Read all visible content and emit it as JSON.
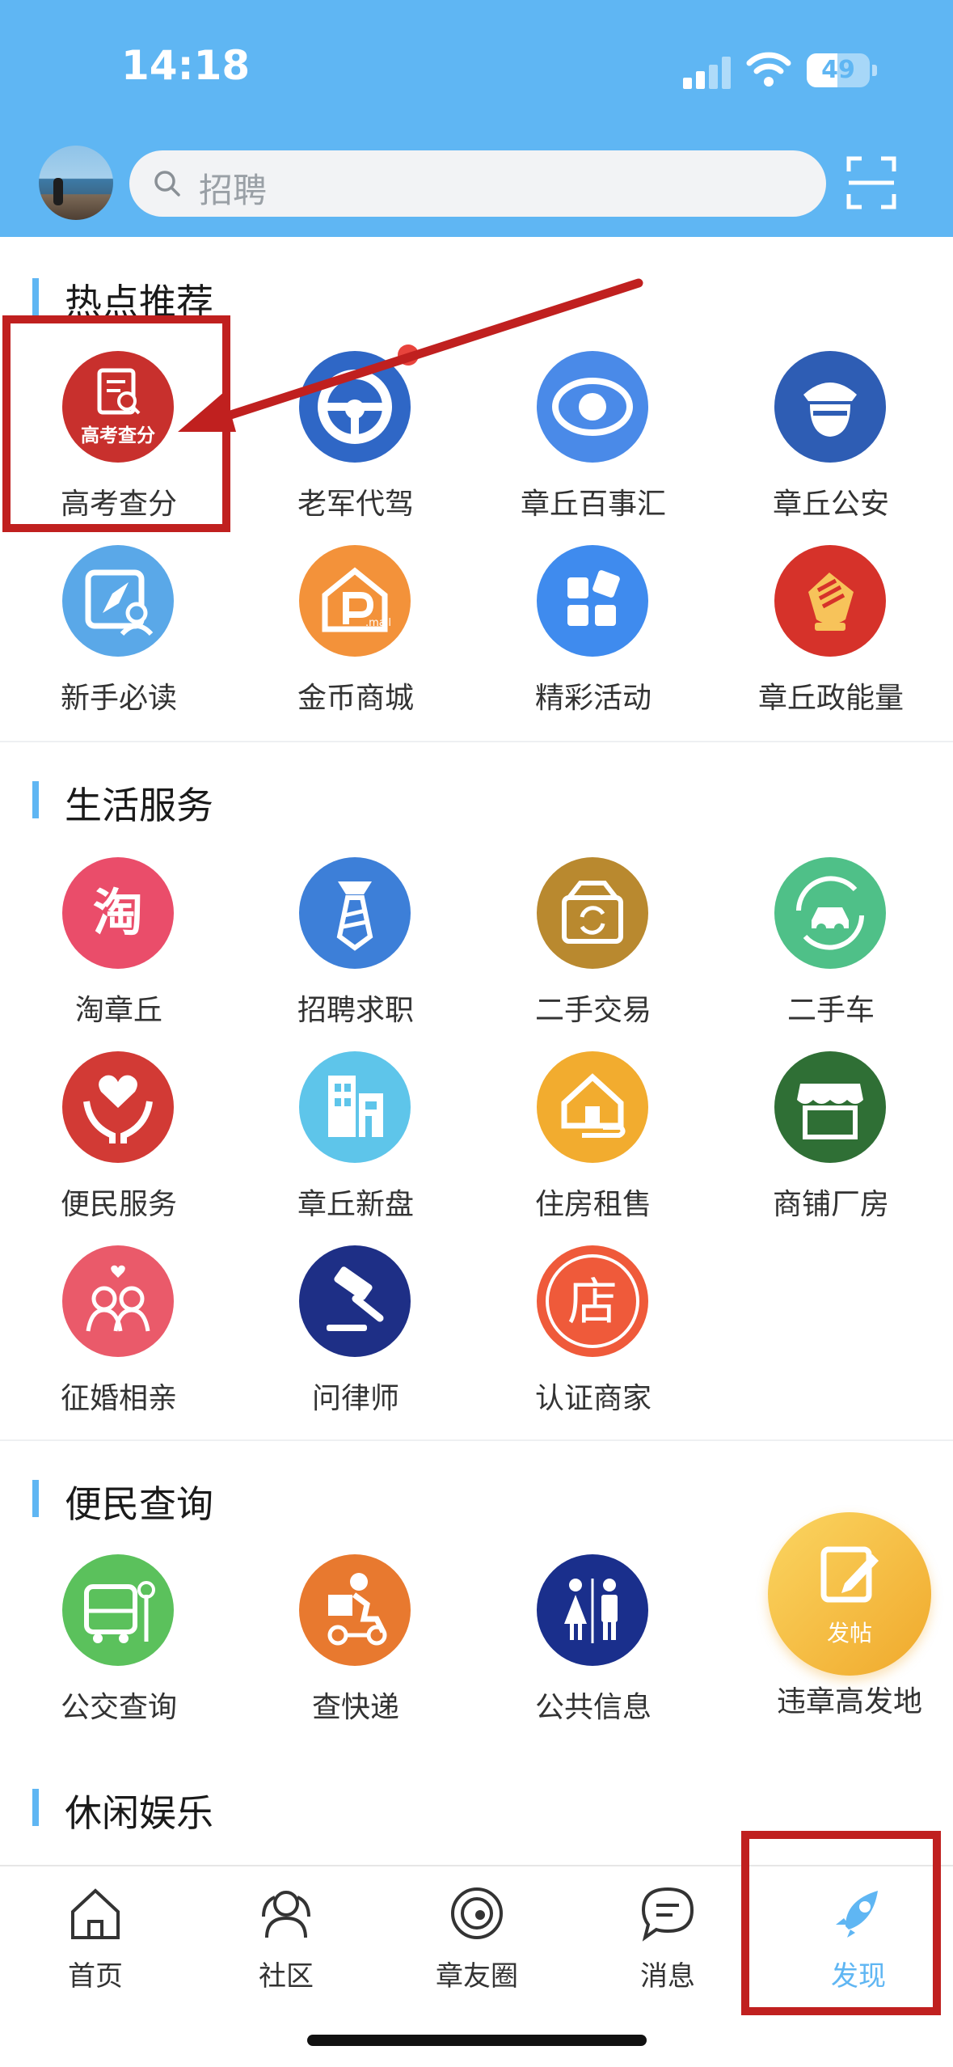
{
  "status_bar": {
    "time": "14:18",
    "battery": "49"
  },
  "search": {
    "placeholder": "招聘"
  },
  "sections": [
    {
      "title": "热点推荐",
      "items": [
        {
          "label": "高考查分",
          "icon_text": "高考查分",
          "icon": "score-search-icon",
          "color": "#c8302d"
        },
        {
          "label": "老军代驾",
          "icon": "steering-wheel-icon",
          "color": "#2f67c6"
        },
        {
          "label": "章丘百事汇",
          "icon": "eye-icon",
          "color": "#4a8ae8"
        },
        {
          "label": "章丘公安",
          "icon": "police-icon",
          "color": "#2e5db4"
        },
        {
          "label": "新手必读",
          "icon": "guide-icon",
          "color": "#5aa8e8"
        },
        {
          "label": "金币商城",
          "icon": "mall-icon",
          "color": "#f3923a",
          "icon_text": ".mall"
        },
        {
          "label": "精彩活动",
          "icon": "apps-icon",
          "color": "#3f8bee"
        },
        {
          "label": "章丘政能量",
          "icon": "fist-icon",
          "color": "#d6322a"
        }
      ]
    },
    {
      "title": "生活服务",
      "items": [
        {
          "label": "淘章丘",
          "icon": "tao-icon",
          "color": "#ea4d6a",
          "icon_text": "淘"
        },
        {
          "label": "招聘求职",
          "icon": "tie-icon",
          "color": "#3d7fd8"
        },
        {
          "label": "二手交易",
          "icon": "recycle-box-icon",
          "color": "#b9892f"
        },
        {
          "label": "二手车",
          "icon": "car-cycle-icon",
          "color": "#4fc088"
        },
        {
          "label": "便民服务",
          "icon": "heart-hands-icon",
          "color": "#d23a35"
        },
        {
          "label": "章丘新盘",
          "icon": "building-icon",
          "color": "#5ec5ea"
        },
        {
          "label": "住房租售",
          "icon": "house-hand-icon",
          "color": "#f2ac2f"
        },
        {
          "label": "商铺厂房",
          "icon": "shop-icon",
          "color": "#2f6f35"
        },
        {
          "label": "征婚相亲",
          "icon": "couple-icon",
          "color": "#ea5a6a"
        },
        {
          "label": "问律师",
          "icon": "gavel-icon",
          "color": "#1e2f86"
        },
        {
          "label": "认证商家",
          "icon": "store-badge-icon",
          "color": "#ef5a3a",
          "icon_text": "店"
        }
      ]
    },
    {
      "title": "便民查询",
      "items": [
        {
          "label": "公交查询",
          "icon": "bus-icon",
          "color": "#5bc15c"
        },
        {
          "label": "查快递",
          "icon": "courier-icon",
          "color": "#e8792f"
        },
        {
          "label": "公共信息",
          "icon": "restroom-icon",
          "color": "#1a2f8c"
        }
      ]
    },
    {
      "title": "休闲娱乐",
      "items": []
    }
  ],
  "fab": {
    "text": "发帖",
    "label": "违章高发地"
  },
  "tabbar": [
    {
      "label": "首页",
      "icon": "home-icon"
    },
    {
      "label": "社区",
      "icon": "community-icon"
    },
    {
      "label": "章友圈",
      "icon": "circle-icon"
    },
    {
      "label": "消息",
      "icon": "message-icon"
    },
    {
      "label": "发现",
      "icon": "rocket-icon",
      "active": true
    }
  ],
  "colors": {
    "primary": "#5fb6f3",
    "highlight": "#c0201f"
  }
}
